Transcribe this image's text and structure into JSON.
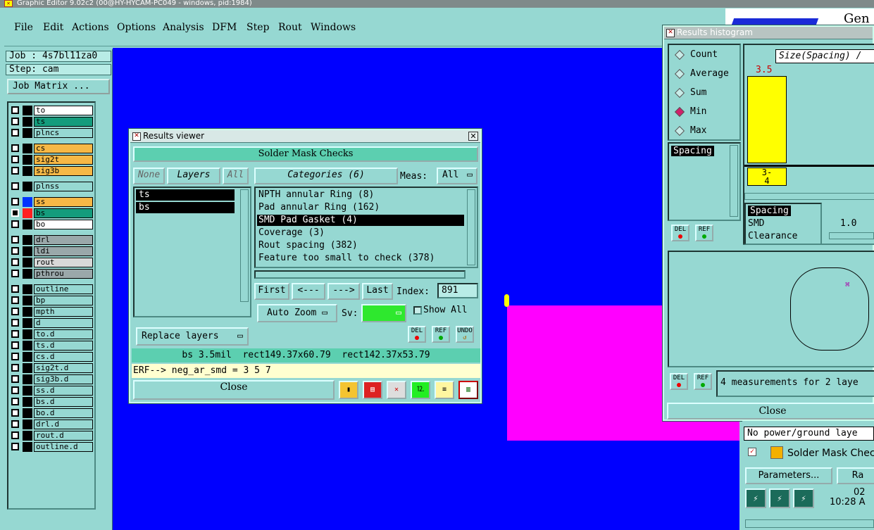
{
  "window": {
    "title": "Graphic Editor 9.02c2 (00@HY-HYCAM-PC049 - windows, pid:1984)"
  },
  "menu": [
    "File",
    "Edit",
    "Actions",
    "Options",
    "Analysis",
    "DFM",
    "Step",
    "Rout",
    "Windows"
  ],
  "sidebar": {
    "job": "Job : 4s7bl11za0",
    "step": "Step: cam",
    "job_matrix": "Job Matrix ...",
    "layers": [
      {
        "name": "to",
        "color": "#ffffff"
      },
      {
        "name": "ts",
        "color": "#149c7c"
      },
      {
        "name": "plncs",
        "color": "#96d8d2"
      },
      {
        "name": "cs",
        "color": "#f6b846"
      },
      {
        "name": "sig2t",
        "color": "#f6b846"
      },
      {
        "name": "sig3b",
        "color": "#f6b846"
      },
      {
        "name": "plnss",
        "color": "#96d8d2"
      },
      {
        "name": "ss",
        "color": "#f6b846"
      },
      {
        "name": "bs",
        "color": "#149c7c"
      },
      {
        "name": "bo",
        "color": "#ffffff"
      },
      {
        "name": "drl",
        "color": "#9aa8aa"
      },
      {
        "name": "ldi",
        "color": "#9aa8aa"
      },
      {
        "name": "rout",
        "color": "#d8d8d8"
      },
      {
        "name": "pthrou",
        "color": "#9aa8aa"
      },
      {
        "name": "outline",
        "color": "#96d8d2"
      },
      {
        "name": "bp",
        "color": "#96d8d2"
      },
      {
        "name": "mpth",
        "color": "#96d8d2"
      },
      {
        "name": "d",
        "color": "#96d8d2"
      },
      {
        "name": "to.d",
        "color": "#96d8d2"
      },
      {
        "name": "ts.d",
        "color": "#96d8d2"
      },
      {
        "name": "cs.d",
        "color": "#96d8d2"
      },
      {
        "name": "sig2t.d",
        "color": "#96d8d2"
      },
      {
        "name": "sig3b.d",
        "color": "#96d8d2"
      },
      {
        "name": "ss.d",
        "color": "#96d8d2"
      },
      {
        "name": "bs.d",
        "color": "#96d8d2"
      },
      {
        "name": "bo.d",
        "color": "#96d8d2"
      },
      {
        "name": "drl.d",
        "color": "#96d8d2"
      },
      {
        "name": "rout.d",
        "color": "#96d8d2"
      },
      {
        "name": "outline.d",
        "color": "#96d8d2"
      }
    ]
  },
  "results_viewer": {
    "title": "Results viewer",
    "header": "Solder Mask Checks",
    "none": "None",
    "layers": "Layers",
    "all": "All",
    "categories_label": "Categories (6)",
    "meas_label": "Meas:",
    "meas_value": "All",
    "layer_items": [
      "ts",
      "bs"
    ],
    "category_items": [
      "NPTH annular Ring (8)",
      "Pad annular Ring (162)",
      "SMD Pad Gasket (4)",
      "Coverage (3)",
      "Rout spacing (382)",
      "Feature too small to check (378)"
    ],
    "first": "First",
    "prev": "<---",
    "next": "--->",
    "last": "Last",
    "index_label": "Index:",
    "index_value": "891",
    "auto_zoom": "Auto Zoom",
    "sv_label": "Sv:",
    "show_all": "Show All",
    "replace_layers": "Replace layers",
    "del": "DEL",
    "ref": "REF",
    "undo": "UNDO",
    "status": "bs 3.5mil  rect149.37x60.79  rect142.37x53.79",
    "erf": "ERF--> neg_ar_smd = 3 5 7",
    "close": "Close"
  },
  "histogram": {
    "title": "Results histogram",
    "modes": [
      "Count",
      "Average",
      "Sum",
      "Min",
      "Max"
    ],
    "selected_mode": "Min",
    "axis_title": "Size(Spacing) /",
    "bar_value": "3.5",
    "bar_range": "3-\n4",
    "left_list": [
      "Spacing"
    ],
    "right_list": [
      "Spacing",
      "SMD",
      "Clearance"
    ],
    "slider_value": "1.0",
    "del": "DEL",
    "ref": "REF",
    "measurements": "4 measurements for 2 laye",
    "close": "Close"
  },
  "right_panel": {
    "header_fragment": "Gen",
    "no_power": "No power/ground laye",
    "check_name": "Solder Mask Check",
    "parameters": "Parameters...",
    "run_fragment": "Ra",
    "date_fragment": "02 ",
    "time_fragment": "10:28 A"
  }
}
